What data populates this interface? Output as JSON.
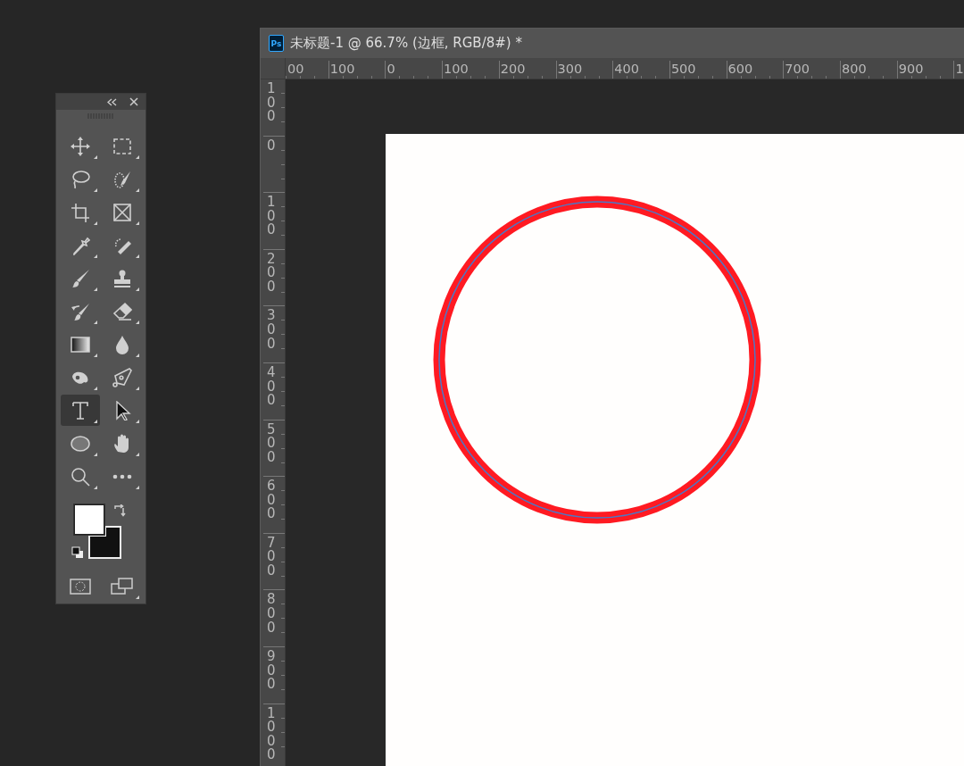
{
  "toolbar": {
    "tools": [
      {
        "kind": "move",
        "selected": false
      },
      {
        "kind": "marquee",
        "selected": false
      },
      {
        "kind": "lasso",
        "selected": false
      },
      {
        "kind": "quick-select",
        "selected": false
      },
      {
        "kind": "crop",
        "selected": false
      },
      {
        "kind": "frame",
        "selected": false
      },
      {
        "kind": "eyedropper",
        "selected": false
      },
      {
        "kind": "healing",
        "selected": false
      },
      {
        "kind": "brush",
        "selected": false
      },
      {
        "kind": "stamp",
        "selected": false
      },
      {
        "kind": "history-brush",
        "selected": false
      },
      {
        "kind": "eraser",
        "selected": false
      },
      {
        "kind": "gradient",
        "selected": false
      },
      {
        "kind": "blur",
        "selected": false
      },
      {
        "kind": "dodge",
        "selected": false
      },
      {
        "kind": "pen",
        "selected": false
      },
      {
        "kind": "type",
        "selected": true
      },
      {
        "kind": "path-select",
        "selected": false
      },
      {
        "kind": "ellipse",
        "selected": false
      },
      {
        "kind": "hand",
        "selected": false
      },
      {
        "kind": "zoom",
        "selected": false
      },
      {
        "kind": "more",
        "selected": false
      }
    ],
    "foreground": {
      "color": "#ffffff"
    },
    "background": {
      "color": "#111111"
    }
  },
  "document": {
    "app_badge": "Ps",
    "title": "未标题-1 @ 66.7% (边框, RGB/8#) *",
    "top_ruler": {
      "labels": [
        "00",
        "100",
        "0",
        "100",
        "200",
        "300",
        "400",
        "500",
        "600",
        "700",
        "800",
        "900",
        "1"
      ]
    },
    "left_ruler": {
      "labels": [
        "100",
        "0",
        "100",
        "200",
        "300",
        "400",
        "500",
        "600",
        "700",
        "800",
        "900",
        "1000"
      ]
    }
  }
}
